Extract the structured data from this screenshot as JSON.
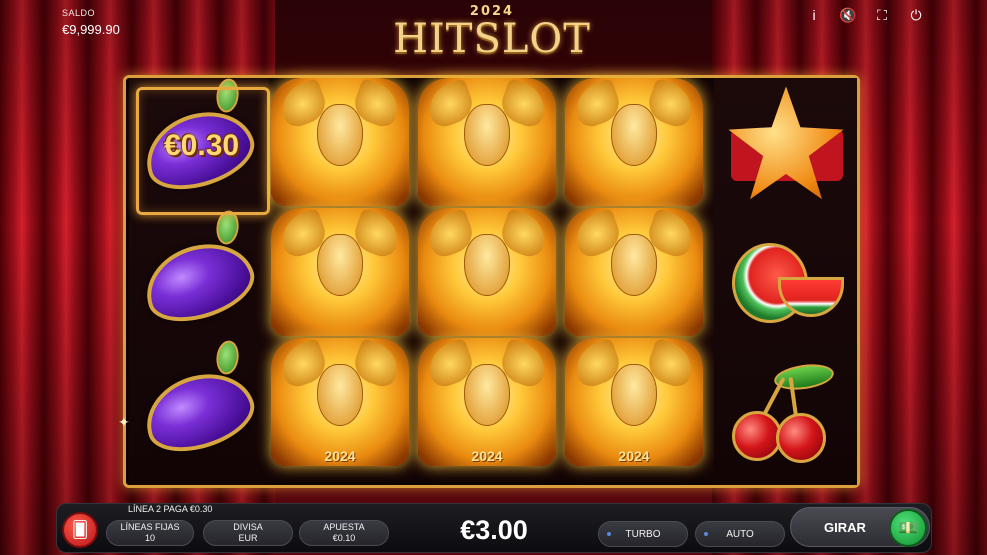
{
  "balance": {
    "label": "SALDO",
    "value": "€9,999.90"
  },
  "logo": {
    "year": "2024",
    "name": "HITSLOT"
  },
  "top_icons": [
    {
      "name": "info-icon",
      "glyph": "i"
    },
    {
      "name": "sound-muted-icon",
      "glyph": "🔇"
    },
    {
      "name": "fullscreen-icon",
      "glyph": "⛶"
    },
    {
      "name": "power-icon",
      "glyph": "⏻"
    }
  ],
  "reels": {
    "win_amount": "€0.30",
    "joker_year": "2024",
    "symbols": [
      [
        "plum",
        "plum",
        "plum"
      ],
      [
        "joker",
        "joker",
        "joker"
      ],
      [
        "joker",
        "joker",
        "joker"
      ],
      [
        "joker",
        "joker",
        "joker"
      ],
      [
        "star",
        "watermelon",
        "cherries"
      ]
    ]
  },
  "bottom": {
    "payline_text": "LÍNEA 2 PAGA €0.30",
    "lines": {
      "label": "LÍNEAS FIJAS",
      "value": "10"
    },
    "currency": {
      "label": "DIVISA",
      "value": "EUR"
    },
    "bet": {
      "label": "APUESTA",
      "value": "€0.10"
    },
    "total_bet": "€3.00",
    "turbo_label": "TURBO",
    "auto_label": "AUTO",
    "spin_label": "GIRAR"
  },
  "colors": {
    "frame_gold": "#d9a03c",
    "curtain_red": "#d2202c",
    "spin_green": "#12902e"
  }
}
